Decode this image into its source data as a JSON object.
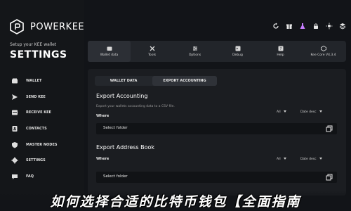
{
  "brand": {
    "name": "POWERKEE",
    "tagline": "Setup your KEE wallet"
  },
  "sidebar": {
    "title": "SETTINGS",
    "items": [
      {
        "label": "WALLET",
        "icon": "wallet-icon"
      },
      {
        "label": "SEND KEE",
        "icon": "send-icon"
      },
      {
        "label": "RECEIVE KEE",
        "icon": "receive-icon"
      },
      {
        "label": "CONTACTS",
        "icon": "contacts-icon"
      },
      {
        "label": "MASTER NODES",
        "icon": "shield-icon"
      },
      {
        "label": "SETTINGS",
        "icon": "gear-icon"
      },
      {
        "label": "FAQ",
        "icon": "chat-icon"
      }
    ]
  },
  "topbar_icons": [
    "refresh-icon",
    "gift-icon",
    "flask-icon",
    "lock-icon",
    "sun-icon",
    "stack-icon"
  ],
  "tabs": [
    {
      "label": "Wallet data",
      "icon": "wallet-data-icon",
      "active": true
    },
    {
      "label": "Tools",
      "icon": "tools-icon",
      "active": false
    },
    {
      "label": "Options",
      "icon": "options-icon",
      "active": false
    },
    {
      "label": "Debug",
      "icon": "debug-icon",
      "active": false
    },
    {
      "label": "Help",
      "icon": "help-icon",
      "active": false
    },
    {
      "label": "Kee Core V4.3.4",
      "icon": "core-icon",
      "active": false
    }
  ],
  "subtabs": {
    "wallet_data": "WALLET DATA",
    "export_accounting": "EXPORT ACCOUNTING"
  },
  "export_accounting": {
    "title": "Export Accounting",
    "description": "Export your wallets accounting data to a CSV file.",
    "where_label": "Where",
    "filter": "All",
    "sort": "Date desc",
    "folder_placeholder": "Select folder"
  },
  "export_address_book": {
    "title": "Export Address Book",
    "where_label": "Where",
    "filter": "All",
    "sort": "Date desc",
    "folder_placeholder": "Select folder"
  },
  "banner": "如何选择合适的比特币钱包【全面指南"
}
